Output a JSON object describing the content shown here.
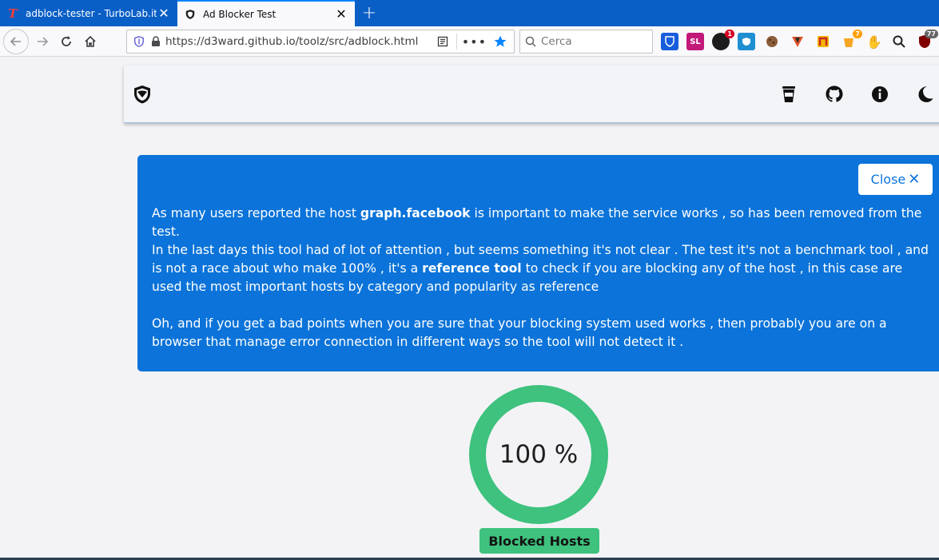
{
  "tabs": [
    {
      "title": "adblock-tester - TurboLab.it",
      "favicon_letter": "T",
      "active": false
    },
    {
      "title": "Ad Blocker Test",
      "active": true
    }
  ],
  "url": "https://d3ward.github.io/toolz/src/adblock.html",
  "search_placeholder": "Cerca",
  "extensions": [
    {
      "name": "bitwarden-icon",
      "label": ""
    },
    {
      "name": "sl-icon",
      "label": "SL"
    },
    {
      "name": "ext-badge-icon",
      "badge": "1"
    },
    {
      "name": "shield-ext-icon",
      "label": ""
    },
    {
      "name": "cookie-icon",
      "label": ""
    },
    {
      "name": "v-ext-icon",
      "label": ""
    },
    {
      "name": "n-ext-icon",
      "label": ""
    },
    {
      "name": "bucket-ext-icon",
      "badge": "7"
    },
    {
      "name": "hand-icon",
      "label": ""
    },
    {
      "name": "search-ext-icon",
      "label": ""
    },
    {
      "name": "ublock-icon",
      "badge": "77"
    }
  ],
  "notice": {
    "close_label": "Close",
    "p1_before": "As many users reported the host ",
    "p1_bold": "graph.facebook",
    "p1_after": " is important to make the service works , so has been removed from the test.",
    "p2_before": "In the last days this tool had of lot of attention , but seems something it's not clear . The test it's not a benchmark tool , and is not a race about who make 100% , it's a ",
    "p2_bold": "reference tool",
    "p2_after": " to check if you are blocking any of the host , in this case are used the most important hosts by category and popularity as reference",
    "p3": "Oh, and if you get a bad points when you are sure that your blocking system used works , then probably you are on a browser that manage error connection in different ways so the tool will not detect it ."
  },
  "result": {
    "percent_label": "100 %",
    "percent_value": 100,
    "blocked_label": "Blocked Hosts"
  },
  "colors": {
    "accent_blue": "#0b73d9",
    "gauge_green": "#3ec27d",
    "tab_strip": "#0a5fc6"
  }
}
